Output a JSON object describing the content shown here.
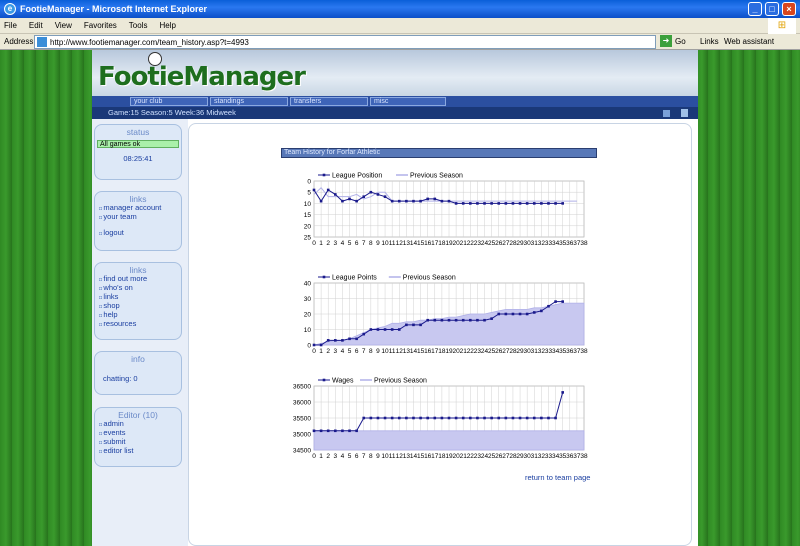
{
  "window": {
    "title": "FootieManager - Microsoft Internet Explorer"
  },
  "menu": [
    "File",
    "Edit",
    "View",
    "Favorites",
    "Tools",
    "Help"
  ],
  "address": {
    "label": "Address",
    "url": "http://www.footiemanager.com/team_history.asp?t=4993",
    "go": "Go",
    "links": "Links",
    "assistant": "Web assistant"
  },
  "site": {
    "logo": "FootieManager",
    "nav": [
      "your club",
      "standings",
      "transfers",
      "misc"
    ],
    "gameinfo": "Game:15  Season:5  Week:36 Midweek"
  },
  "sidebar": {
    "status": {
      "title": "status",
      "ok": "All games ok",
      "time": "08:25:41"
    },
    "links1": {
      "title": "links",
      "items": [
        "manager account",
        "your team",
        "logout"
      ]
    },
    "links2": {
      "title": "links",
      "items": [
        "find out more",
        "who's on",
        "links",
        "shop",
        "help",
        "resources"
      ]
    },
    "info": {
      "title": "info",
      "chatting": "chatting: 0"
    },
    "editor": {
      "title": "Editor (10)",
      "items": [
        "admin",
        "events",
        "submit",
        "editor list"
      ]
    }
  },
  "page": {
    "heading": "Team History for Forfar Athletic",
    "return_link": "return to team page"
  },
  "colors": {
    "series": "#1a1a8c",
    "previous": "#b0b0e8",
    "fill": "#c8c8f0"
  },
  "chart_data": [
    {
      "type": "line",
      "legend": [
        "League Position",
        "Previous Season"
      ],
      "ylim": [
        25,
        0
      ],
      "yticks": [
        0,
        5,
        10,
        15,
        20,
        25
      ],
      "x": [
        0,
        1,
        2,
        3,
        4,
        5,
        6,
        7,
        8,
        9,
        10,
        11,
        12,
        13,
        14,
        15,
        16,
        17,
        18,
        19,
        20,
        21,
        22,
        23,
        24,
        25,
        26,
        27,
        28,
        29,
        30,
        31,
        32,
        33,
        34,
        35,
        36,
        37,
        38
      ],
      "series": [
        {
          "name": "League Position",
          "values": [
            4,
            9,
            4,
            6,
            9,
            8,
            9,
            7,
            5,
            6,
            7,
            9,
            9,
            9,
            9,
            9,
            8,
            8,
            9,
            9,
            10,
            10,
            10,
            10,
            10,
            10,
            10,
            10,
            10,
            10,
            10,
            10,
            10,
            10,
            10,
            10
          ]
        },
        {
          "name": "Previous Season",
          "values": [
            6,
            3,
            7,
            7,
            7,
            7,
            6,
            8,
            7,
            5,
            5,
            9,
            9,
            9,
            9,
            9,
            9,
            9,
            9,
            9,
            9,
            9,
            9,
            9,
            9,
            9,
            9,
            9,
            9,
            9,
            9,
            9,
            9,
            9,
            9,
            9,
            9,
            9
          ]
        }
      ]
    },
    {
      "type": "area",
      "legend": [
        "League Points",
        "Previous Season"
      ],
      "ylim": [
        0,
        40
      ],
      "yticks": [
        0,
        10,
        20,
        30,
        40
      ],
      "x": [
        0,
        1,
        2,
        3,
        4,
        5,
        6,
        7,
        8,
        9,
        10,
        11,
        12,
        13,
        14,
        15,
        16,
        17,
        18,
        19,
        20,
        21,
        22,
        23,
        24,
        25,
        26,
        27,
        28,
        29,
        30,
        31,
        32,
        33,
        34,
        35,
        36,
        37,
        38
      ],
      "series": [
        {
          "name": "League Points",
          "values": [
            0,
            0,
            3,
            3,
            3,
            4,
            4,
            7,
            10,
            10,
            10,
            10,
            10,
            13,
            13,
            13,
            16,
            16,
            16,
            16,
            16,
            16,
            16,
            16,
            16,
            17,
            20,
            20,
            20,
            20,
            20,
            21,
            22,
            25,
            28,
            28
          ]
        },
        {
          "name": "Previous Season",
          "values": [
            0,
            1,
            2,
            3,
            3,
            4,
            6,
            8,
            10,
            11,
            12,
            14,
            14,
            15,
            15,
            16,
            16,
            17,
            17,
            18,
            18,
            19,
            20,
            20,
            20,
            21,
            22,
            23,
            23,
            23,
            23,
            24,
            24,
            25,
            26,
            27,
            27,
            27,
            27
          ]
        }
      ]
    },
    {
      "type": "area",
      "legend": [
        "Wages",
        "Previous Season"
      ],
      "ylim": [
        34500,
        36500
      ],
      "yticks": [
        34500,
        35000,
        35500,
        36000,
        36500
      ],
      "x": [
        0,
        1,
        2,
        3,
        4,
        5,
        6,
        7,
        8,
        9,
        10,
        11,
        12,
        13,
        14,
        15,
        16,
        17,
        18,
        19,
        20,
        21,
        22,
        23,
        24,
        25,
        26,
        27,
        28,
        29,
        30,
        31,
        32,
        33,
        34,
        35,
        36,
        37,
        38
      ],
      "series": [
        {
          "name": "Wages",
          "values": [
            35100,
            35100,
            35100,
            35100,
            35100,
            35100,
            35100,
            35500,
            35500,
            35500,
            35500,
            35500,
            35500,
            35500,
            35500,
            35500,
            35500,
            35500,
            35500,
            35500,
            35500,
            35500,
            35500,
            35500,
            35500,
            35500,
            35500,
            35500,
            35500,
            35500,
            35500,
            35500,
            35500,
            35500,
            35500,
            36300
          ]
        },
        {
          "name": "Previous Season",
          "values": [
            35100,
            35100,
            35100,
            35100,
            35100,
            35100,
            35100,
            35100,
            35100,
            35100,
            35100,
            35100,
            35100,
            35100,
            35100,
            35100,
            35100,
            35100,
            35100,
            35100,
            35100,
            35100,
            35100,
            35100,
            35100,
            35100,
            35100,
            35100,
            35100,
            35100,
            35100,
            35100,
            35100,
            35100,
            35100,
            35100,
            35100,
            35100,
            35100
          ]
        }
      ]
    }
  ]
}
